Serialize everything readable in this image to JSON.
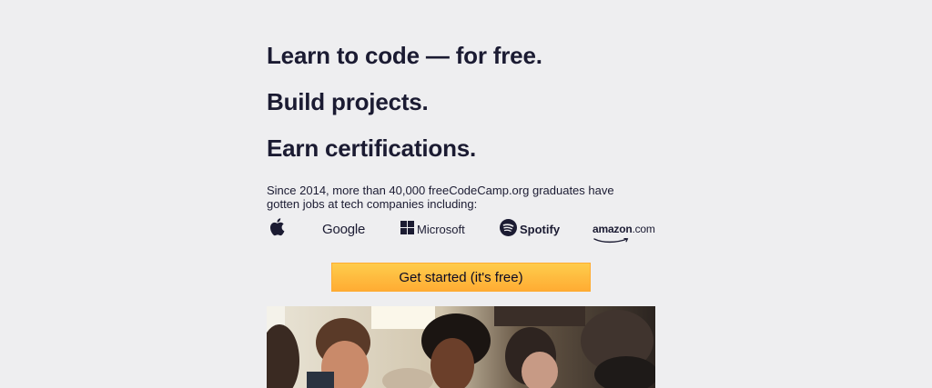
{
  "hero": {
    "headline_1": "Learn to code — for free.",
    "headline_2": "Build projects.",
    "headline_3": "Earn certifications.",
    "intro": "Since 2014, more than 40,000 freeCodeCamp.org graduates have gotten jobs at tech companies including:",
    "cta_label": "Get started (it's free)"
  },
  "companies": {
    "apple": "apple-icon",
    "google": "Google",
    "microsoft": "Microsoft",
    "spotify": "Spotify",
    "amazon_main": "amazon",
    "amazon_sub": ".com"
  },
  "colors": {
    "background": "#eeeef0",
    "text": "#1b1b32",
    "cta_top": "#fecc4c",
    "cta_bottom": "#ffac33"
  }
}
